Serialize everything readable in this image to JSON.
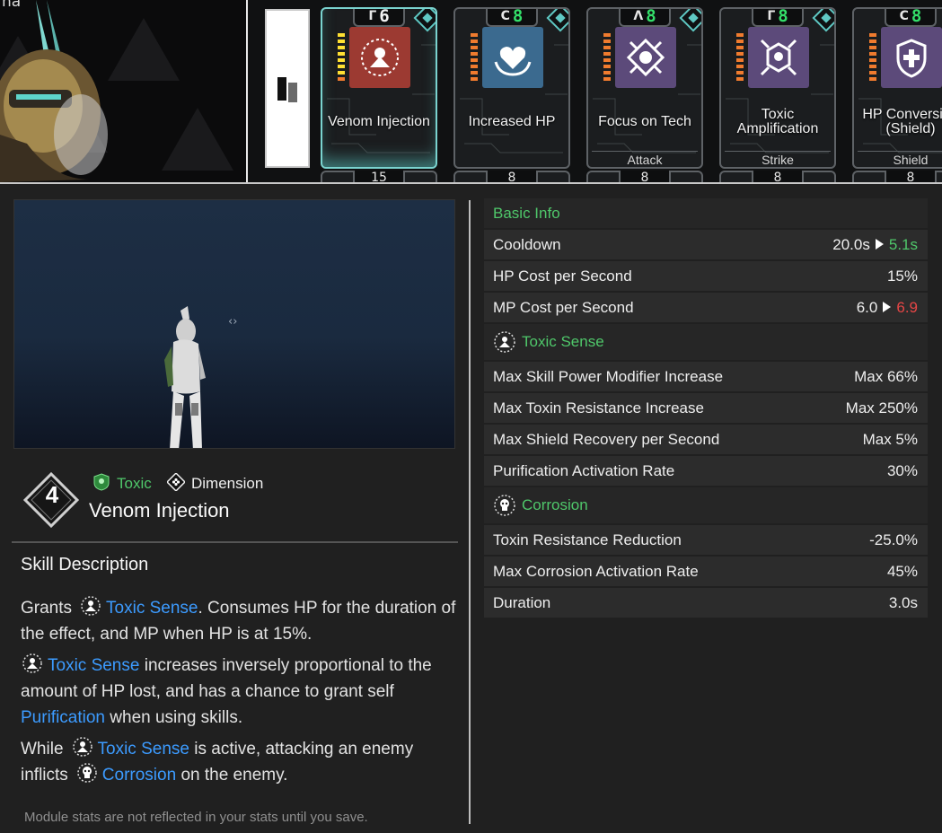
{
  "portrait": {
    "name": "na"
  },
  "top_cards": [
    {
      "socket": "Γ",
      "capacity": "6",
      "capacity_color": "white",
      "name": "Venom Injection",
      "type": "",
      "selected": true,
      "icon_bg": "#9c3a32",
      "level_colors": [
        "yellow",
        "yellow",
        "yellow",
        "yellow",
        "yellow",
        "yellow",
        "yellow",
        "orange"
      ]
    },
    {
      "socket": "C",
      "capacity": "8",
      "capacity_color": "green",
      "name": "Increased HP",
      "type": "",
      "selected": false,
      "icon_bg": "#3b6a8f",
      "level_colors": [
        "orange",
        "orange",
        "orange",
        "orange",
        "orange",
        "orange",
        "orange",
        "orange"
      ]
    },
    {
      "socket": "Λ",
      "capacity": "8",
      "capacity_color": "green",
      "name": "Focus on Tech",
      "type": "Attack",
      "selected": false,
      "icon_bg": "#5c4a7a",
      "level_colors": [
        "orange",
        "orange",
        "orange",
        "orange",
        "orange",
        "orange",
        "orange",
        "orange"
      ]
    },
    {
      "socket": "Γ",
      "capacity": "8",
      "capacity_color": "green",
      "name": "Toxic Amplification",
      "type": "Strike",
      "selected": false,
      "icon_bg": "#5c4a7a",
      "level_colors": [
        "orange",
        "orange",
        "orange",
        "orange",
        "orange",
        "orange",
        "orange",
        "orange"
      ]
    },
    {
      "socket": "C",
      "capacity": "8",
      "capacity_color": "green",
      "name": "HP Conversion (Shield)",
      "type": "Shield",
      "selected": false,
      "icon_bg": "#5c4a7a",
      "level_colors": [
        "orange",
        "orange",
        "orange",
        "orange",
        "orange",
        "orange",
        "orange",
        "orange"
      ]
    }
  ],
  "peek_cards": [
    {
      "label": "15"
    },
    {
      "label": "8"
    },
    {
      "label": "8"
    },
    {
      "label": "8"
    },
    {
      "label": "8"
    }
  ],
  "skill": {
    "level": "4",
    "tag_primary": "Toxic",
    "tag_secondary": "Dimension",
    "name": "Venom Injection"
  },
  "description": {
    "title": "Skill Description",
    "p1_pre": "Grants",
    "p1_kw": "Toxic Sense",
    "p1_post": ". Consumes HP for the duration of the effect, and MP when HP is at 15%.",
    "p2_kw": "Toxic Sense",
    "p2_mid": " increases inversely proportional to the amount of HP lost, and has a chance to grant self ",
    "p2_kw2": "Purification",
    "p2_post": " when using skills.",
    "p3_pre": "While",
    "p3_kw": "Toxic Sense",
    "p3_mid": " is active, attacking an enemy inflicts",
    "p3_kw2": "Corrosion",
    "p3_post": " on the enemy.",
    "notice": "Module stats are not reflected in your stats until you save."
  },
  "stats": {
    "basic_title": "Basic Info",
    "cooldown": {
      "label": "Cooldown",
      "from": "20.0s",
      "to": "5.1s"
    },
    "hp_cost": {
      "label": "HP Cost per Second",
      "value": "15%"
    },
    "mp_cost": {
      "label": "MP Cost per Second",
      "from": "6.0",
      "to": "6.9"
    },
    "toxic_title": "Toxic Sense",
    "toxic_rows": [
      {
        "label": "Max Skill Power Modifier Increase",
        "value": "Max 66%"
      },
      {
        "label": "Max Toxin Resistance Increase",
        "value": "Max 250%"
      },
      {
        "label": "Max Shield Recovery per Second",
        "value": "Max 5%"
      },
      {
        "label": "Purification Activation Rate",
        "value": "30%"
      }
    ],
    "corrosion_title": "Corrosion",
    "corrosion_rows": [
      {
        "label": "Toxin Resistance Reduction",
        "value": "-25.0%"
      },
      {
        "label": "Max Corrosion Activation Rate",
        "value": "45%"
      },
      {
        "label": "Duration",
        "value": "3.0s"
      }
    ]
  },
  "colors": {
    "accent_green": "#4fc76a",
    "keyword_blue": "#3c9bff",
    "decrease_red": "#e64646",
    "selected_card": "#7ad3cf"
  }
}
